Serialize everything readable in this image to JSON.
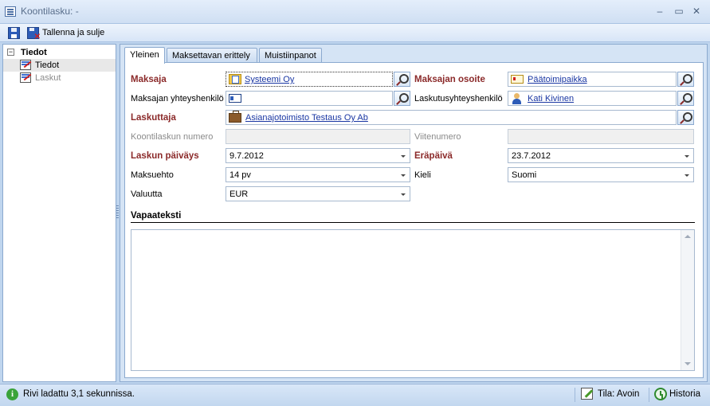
{
  "window": {
    "title": "Koontilasku:",
    "title_suffix": "-",
    "buttons": {
      "minimize": "–",
      "maximize": "▭",
      "close": "✕"
    }
  },
  "toolbar": {
    "save_icon": "save-icon",
    "save_close_icon": "save-close-icon",
    "save_close_label": "Tallenna ja sulje"
  },
  "tree": {
    "root": {
      "label": "Tiedot",
      "expander": "−"
    },
    "items": [
      {
        "label": "Tiedot",
        "selected": true,
        "icon": "invoice-icon"
      },
      {
        "label": "Laskut",
        "selected": false,
        "icon": "invoice-icon"
      }
    ]
  },
  "tabs": [
    {
      "label": "Yleinen",
      "active": true
    },
    {
      "label": "Maksettavan erittely",
      "active": false
    },
    {
      "label": "Muistiinpanot",
      "active": false
    }
  ],
  "form": {
    "maksaja": {
      "label": "Maksaja",
      "value": "Systeemi Oy",
      "icon": "company-icon"
    },
    "maksajan_osoite": {
      "label": "Maksajan osoite",
      "value": "Päätoimipaikka",
      "icon": "address-icon"
    },
    "maksajan_yhteyshenkilo": {
      "label": "Maksajan yhteyshenkilö",
      "value": "",
      "icon": "contact-card-icon"
    },
    "laskutusyhteyshenkilo": {
      "label": "Laskutusyhteyshenkilö",
      "value": "Kati Kivinen",
      "icon": "person-icon"
    },
    "laskuttaja": {
      "label": "Laskuttaja",
      "value": "Asianajotoimisto Testaus Oy Ab",
      "icon": "briefcase-icon"
    },
    "koontilaskun_numero": {
      "label": "Koontilaskun numero",
      "value": ""
    },
    "viitenumero": {
      "label": "Viitenumero",
      "value": ""
    },
    "laskun_paivays": {
      "label": "Laskun päiväys",
      "value": "9.7.2012"
    },
    "erapaiva": {
      "label": "Eräpäivä",
      "value": "23.7.2012"
    },
    "maksuehto": {
      "label": "Maksuehto",
      "value": "14 pv"
    },
    "kieli": {
      "label": "Kieli",
      "value": "Suomi"
    },
    "valuutta": {
      "label": "Valuutta",
      "value": "EUR"
    },
    "vapaateksti": {
      "label": "Vapaateksti",
      "value": ""
    }
  },
  "status": {
    "message": "Rivi ladattu 3,1 sekunnissa.",
    "state_label": "Tila: Avoin",
    "history_label": "Historia"
  },
  "colors": {
    "required_label": "#8b2a2a",
    "link": "#1a37a3",
    "panel_border": "#8ba9cf",
    "background": "#bfd5ee"
  }
}
